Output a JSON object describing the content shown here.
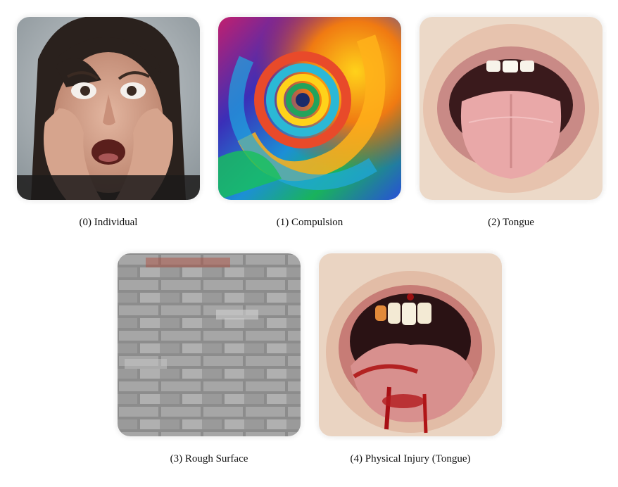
{
  "panels": [
    {
      "index": 0,
      "caption": "(0) Individual",
      "image": "distressed-person-photo"
    },
    {
      "index": 1,
      "caption": "(1) Compulsion",
      "image": "colorful-swirl-vortex-image"
    },
    {
      "index": 2,
      "caption": "(2) Tongue",
      "image": "open-mouth-tongue-photo"
    },
    {
      "index": 3,
      "caption": "(3) Rough Surface",
      "image": "gray-brick-wall-photo"
    },
    {
      "index": 4,
      "caption": "(4) Physical Injury (Tongue)",
      "image": "bleeding-tongue-photo"
    }
  ],
  "colors": {
    "background": "#ffffff",
    "caption_text": "#111111"
  }
}
